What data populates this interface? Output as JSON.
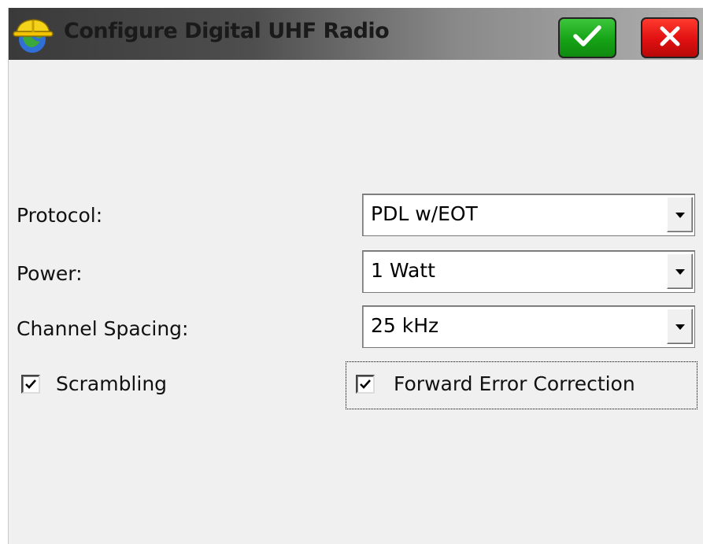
{
  "window": {
    "title": "Configure Digital UHF Radio",
    "app_icon": "hardhat-globe-icon",
    "ok_icon": "checkmark-icon",
    "cancel_icon": "close-x-icon",
    "colors": {
      "ok": "#16a316",
      "cancel": "#e01010",
      "background": "#f0f0f0"
    }
  },
  "form": {
    "protocol": {
      "label": "Protocol:",
      "value": "PDL w/EOT"
    },
    "power": {
      "label": "Power:",
      "value": "1 Watt"
    },
    "channel_spacing": {
      "label": "Channel Spacing:",
      "value": "25 kHz"
    },
    "scrambling": {
      "label": "Scrambling",
      "checked": true
    },
    "fec": {
      "label": "Forward Error Correction",
      "checked": true
    }
  }
}
